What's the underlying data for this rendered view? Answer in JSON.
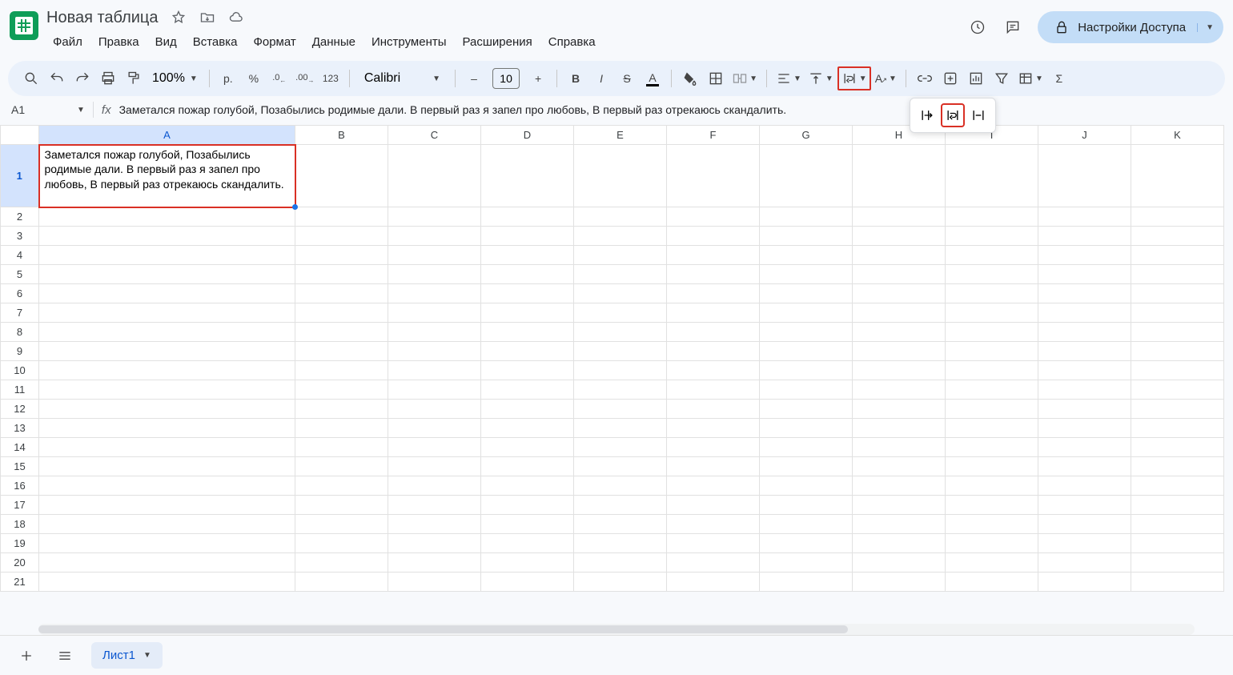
{
  "header": {
    "title": "Новая таблица",
    "share_label": "Настройки Доступа"
  },
  "menus": [
    "Файл",
    "Правка",
    "Вид",
    "Вставка",
    "Формат",
    "Данные",
    "Инструменты",
    "Расширения",
    "Справка"
  ],
  "toolbar": {
    "zoom": "100%",
    "currency": "р.",
    "percent": "%",
    "dec_dec": ".0",
    "dec_inc": ".00",
    "num123": "123",
    "font": "Calibri",
    "font_size": "10",
    "minus": "–",
    "plus": "+",
    "bold": "B",
    "italic": "I"
  },
  "namebox": {
    "ref": "A1",
    "formula": "Заметался пожар голубой, Позабылись родимые дали. В первый раз я запел про любовь, В первый раз отрекаюсь скандалить."
  },
  "columns": [
    "A",
    "B",
    "C",
    "D",
    "E",
    "F",
    "G",
    "H",
    "I",
    "J",
    "K"
  ],
  "rows": [
    1,
    2,
    3,
    4,
    5,
    6,
    7,
    8,
    9,
    10,
    11,
    12,
    13,
    14,
    15,
    16,
    17,
    18,
    19,
    20,
    21
  ],
  "cells": {
    "A1": "Заметался пожар голубой, Позабылись родимые дали. В первый раз я запел про любовь, В первый раз отрекаюсь скандалить."
  },
  "sheet_tab": "Лист1"
}
